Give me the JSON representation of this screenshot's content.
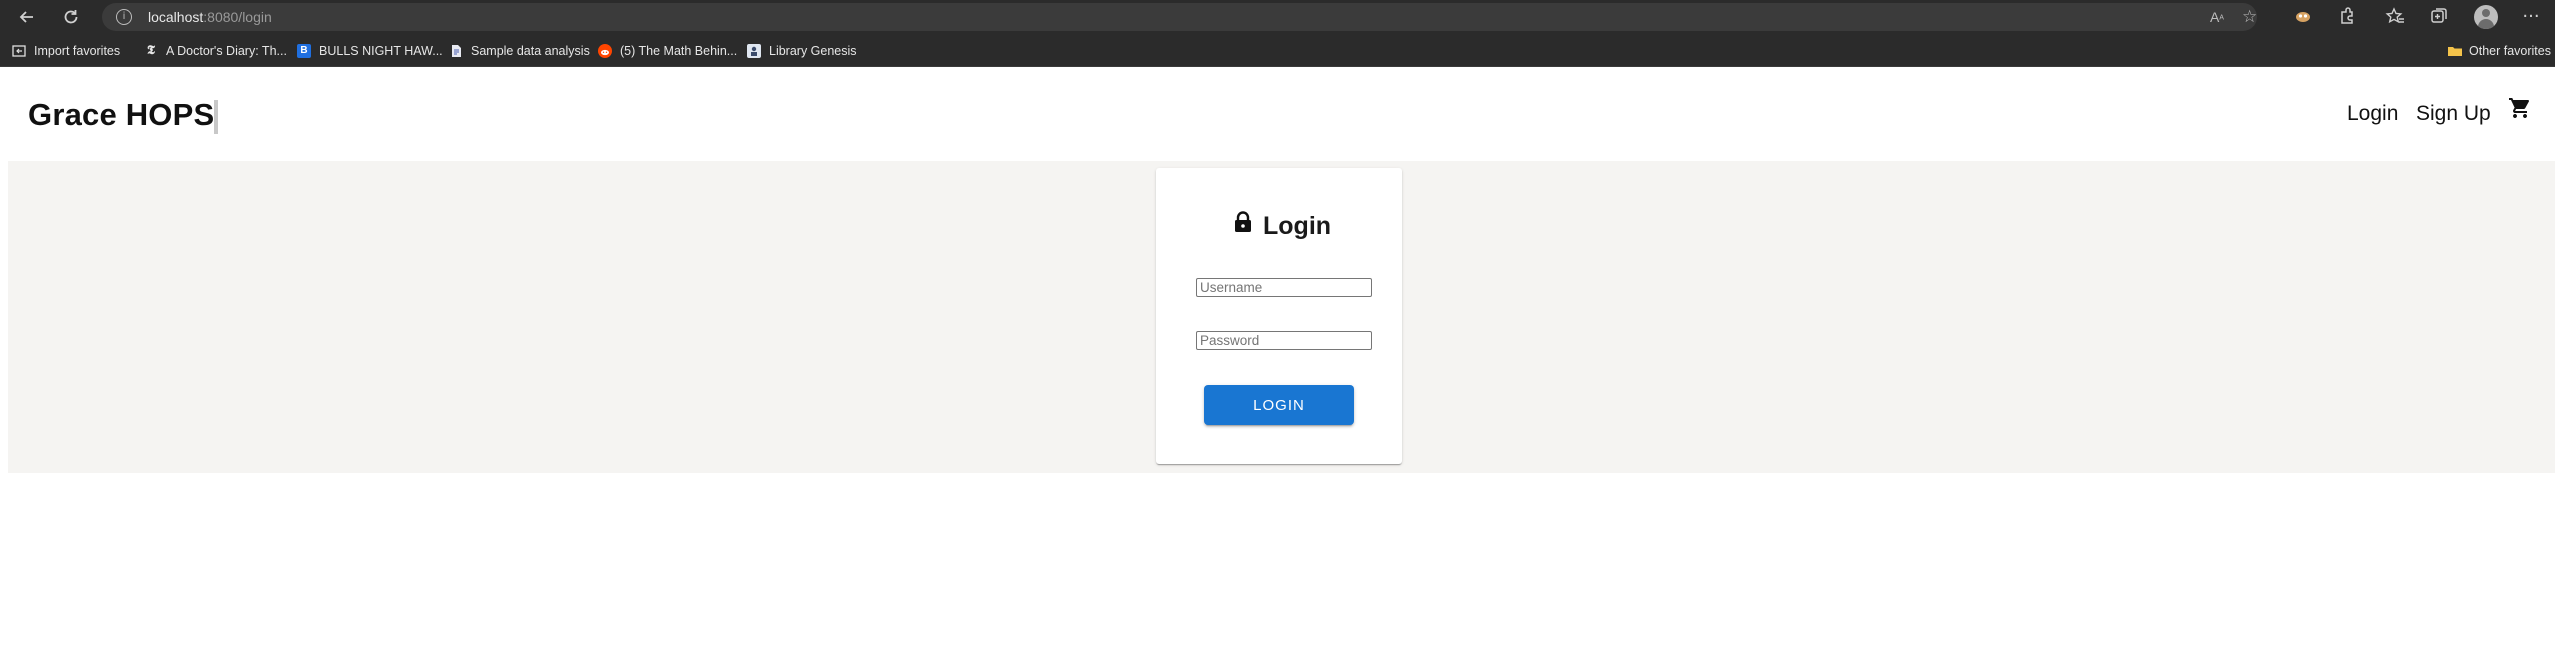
{
  "browser": {
    "url_host": "localhost",
    "url_rest": ":8080/login",
    "icons": [
      "back-icon",
      "refresh-icon",
      "site-info-icon",
      "read-aloud-icon",
      "add-favorite-icon",
      "extension-icon",
      "extensions-icon",
      "favorites-icon",
      "collections-icon",
      "profile-icon",
      "more-icon"
    ],
    "bookmarks": [
      {
        "label": "Import favorites",
        "icon": "import-icon"
      },
      {
        "label": "A Doctor's Diary: Th...",
        "icon": "nyt-icon"
      },
      {
        "label": "BULLS NIGHT HAW...",
        "icon": "bulls-icon"
      },
      {
        "label": "Sample data analysis",
        "icon": "doc-icon"
      },
      {
        "label": "(5) The Math Behin...",
        "icon": "reddit-icon"
      },
      {
        "label": "Library Genesis",
        "icon": "libgen-icon"
      }
    ],
    "other_favorites": "Other favorites"
  },
  "header": {
    "brand": "Grace HOPS",
    "nav": [
      {
        "label": "Login"
      },
      {
        "label": "Sign Up"
      }
    ],
    "cart_icon": "cart-icon"
  },
  "login": {
    "title": "Login",
    "lock_icon": "lock-icon",
    "username_placeholder": "Username",
    "password_placeholder": "Password",
    "button_label": "LOGIN",
    "accent": "#1976d2"
  }
}
